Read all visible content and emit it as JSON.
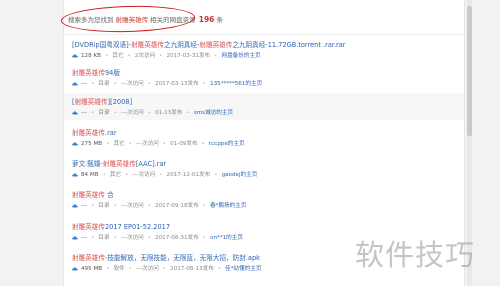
{
  "summary": {
    "prefix": "搜索多为您找到",
    "keyword": "射雕英雄传",
    "middle": "相关的网盘资源",
    "count": "196",
    "suffix": "条"
  },
  "items": [
    {
      "parts": [
        {
          "t": "[DVDRip国粤双语]-",
          "c": "p"
        },
        {
          "t": "射雕英雄传",
          "c": "r"
        },
        {
          "t": "之九阴真经-",
          "c": "p"
        },
        {
          "t": "射雕英雄传",
          "c": "r"
        },
        {
          "t": "之九阴真经-11.72GB.torrent .rar.rar",
          "c": "p"
        }
      ],
      "size": "128 KB",
      "type": "其它",
      "visits": "2次访问",
      "date": "2017-03-31发布",
      "uploader": "网盘备份的主页"
    },
    {
      "parts": [
        {
          "t": "射雕英雄传",
          "c": "r"
        },
        {
          "t": "94版",
          "c": "p"
        }
      ],
      "size": "---",
      "type": "目录",
      "visits": "---次访问",
      "date": "2017-03-13发布",
      "uploader": "135*****561的主页"
    },
    {
      "parts": [
        {
          "t": "[",
          "c": "p"
        },
        {
          "t": "射雕英雄传",
          "c": "r"
        },
        {
          "t": "][2008]",
          "c": "p"
        }
      ],
      "size": "---",
      "type": "目录",
      "visits": "---次访问",
      "date": "01-13发布",
      "uploader": "sms城访的主页"
    },
    {
      "parts": [
        {
          "t": "射雕英雄传",
          "c": "r"
        },
        {
          "t": ".rar",
          "c": "p"
        }
      ],
      "size": "275 MB",
      "type": "其它",
      "visits": "---次访问",
      "date": "01-09发布",
      "uploader": "tccppe的主页"
    },
    {
      "parts": [
        {
          "t": "萝文.甄嬛-",
          "c": "p"
        },
        {
          "t": "射雕英雄传",
          "c": "r"
        },
        {
          "t": "[AAC].rar",
          "c": "p"
        }
      ],
      "size": "84 MB",
      "type": "其它",
      "visits": "---次访问",
      "date": "2017-12-01发布",
      "uploader": "gaodej的主页"
    },
    {
      "parts": [
        {
          "t": "射雕英雄传",
          "c": "r"
        },
        {
          "t": " 合",
          "c": "p"
        }
      ],
      "size": "---",
      "type": "目录",
      "visits": "---次访问",
      "date": "2017-09-18发布",
      "uploader": "春*鹏扬的主页"
    },
    {
      "parts": [
        {
          "t": "射雕英雄传",
          "c": "r"
        },
        {
          "t": "2017 EP01-52.2017",
          "c": "p"
        }
      ],
      "size": "---",
      "type": "目录",
      "visits": "---次访问",
      "date": "2017-08-31发布",
      "uploader": "on**1的主页"
    },
    {
      "parts": [
        {
          "t": "射雕英雄传",
          "c": "r"
        },
        {
          "t": "-技能解放，无限技能，无限蓝，无限大招，防封.apk",
          "c": "p"
        }
      ],
      "size": "495 MB",
      "type": "软件",
      "visits": "---次访问",
      "date": "2017-08-13发布",
      "uploader": "佳*幼懂的主页"
    }
  ],
  "watermark": "软件技巧",
  "colors": {
    "link": "#2d64b3",
    "keyword": "#d9534f",
    "annotation": "#d11a1a"
  },
  "icons": {
    "meta": "baidu-cloud-icon"
  }
}
